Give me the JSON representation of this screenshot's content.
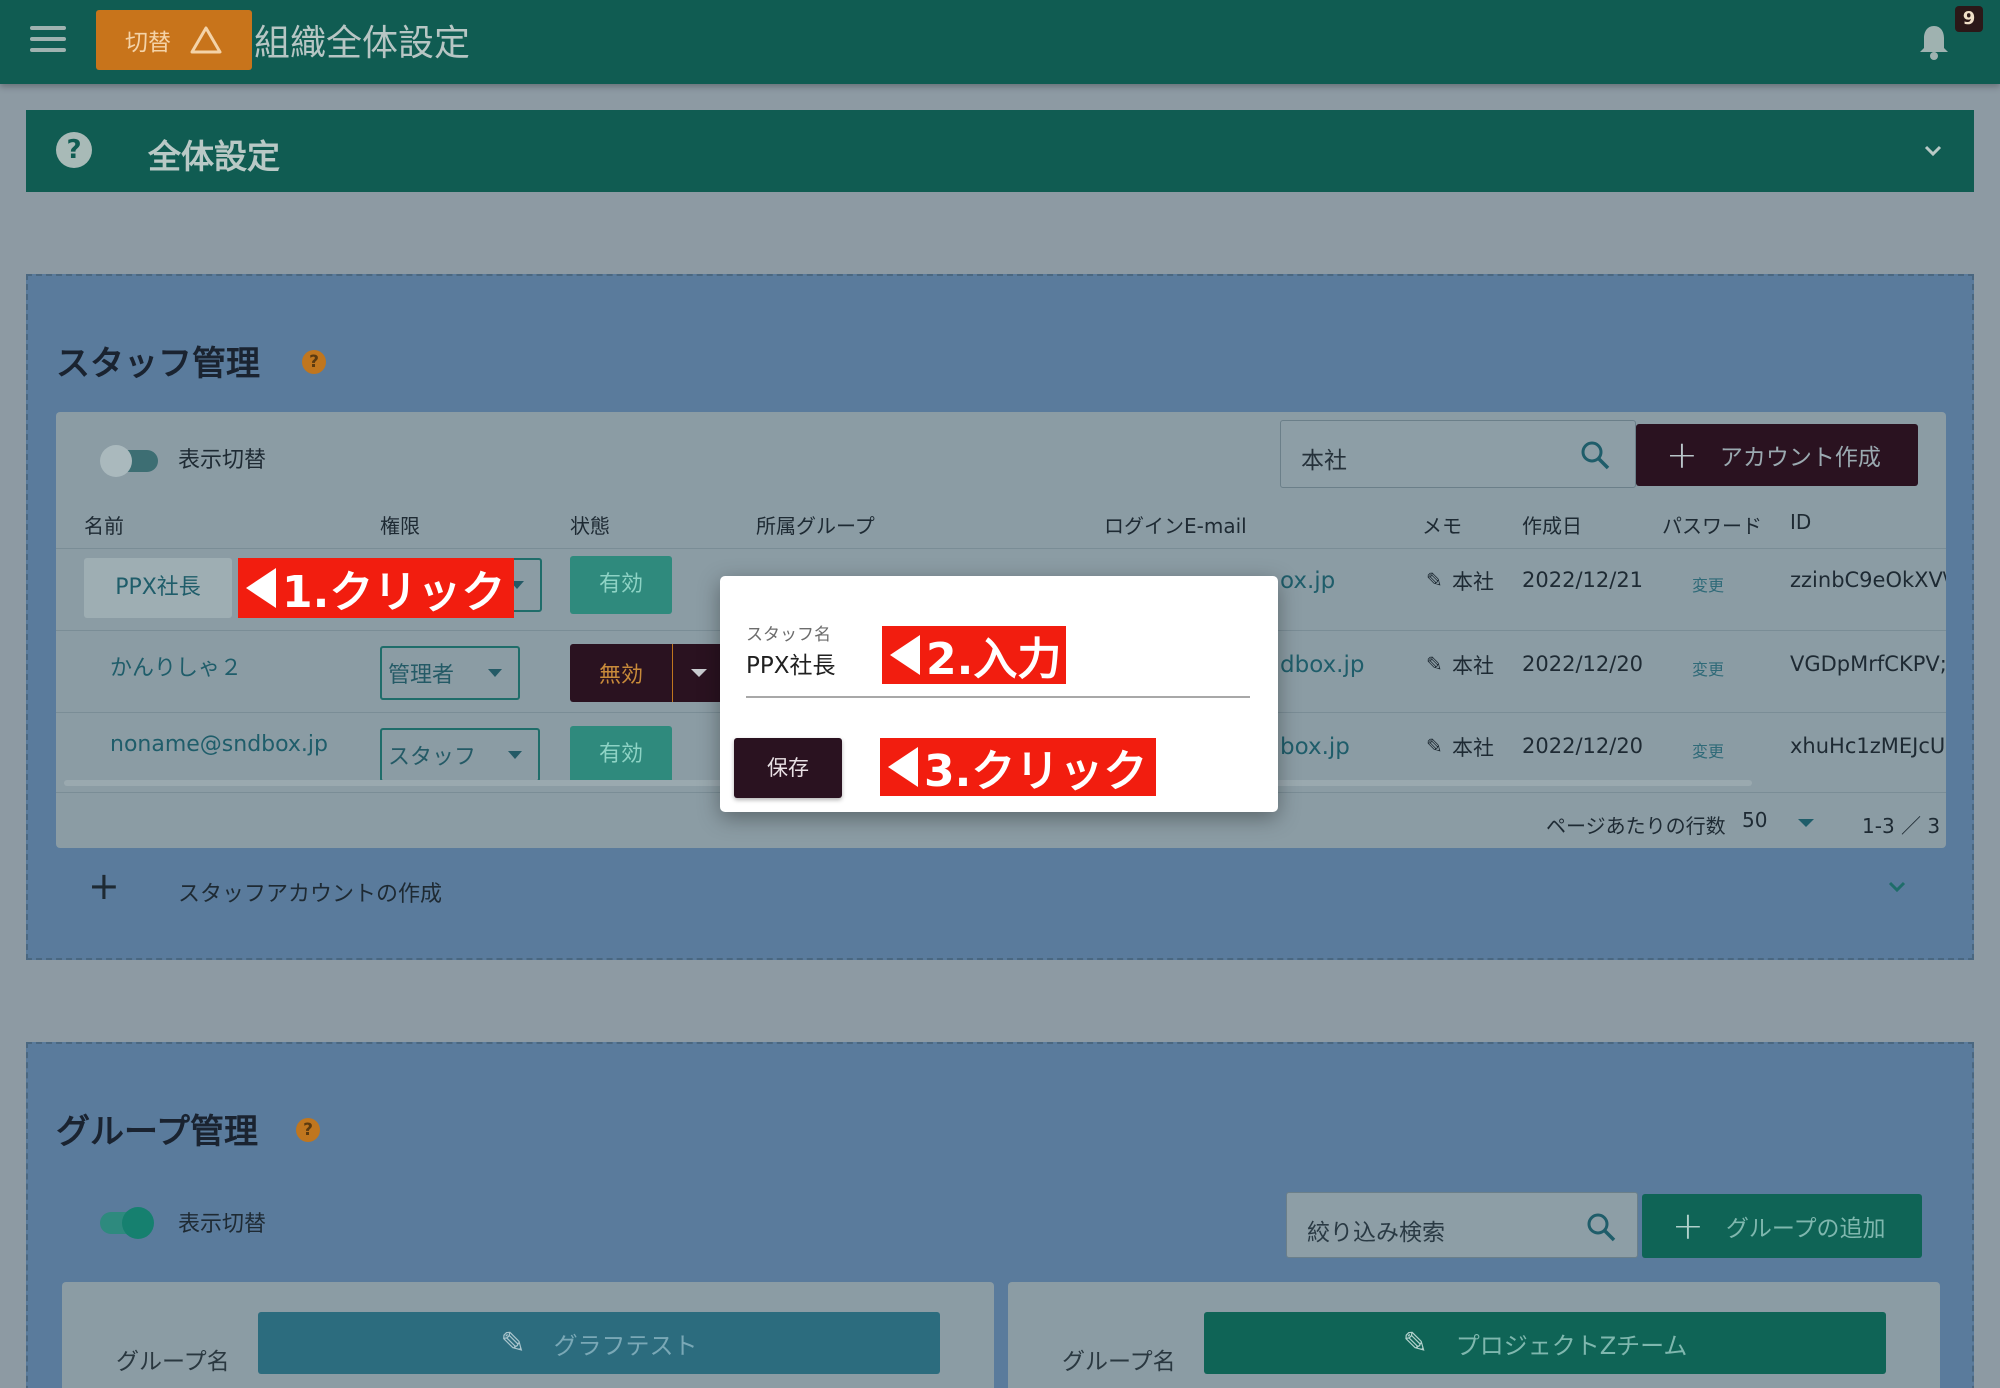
{
  "header": {
    "switch_label": "切替",
    "title": "組織全体設定",
    "notification_count": "9"
  },
  "settings": {
    "title": "全体設定"
  },
  "staff": {
    "title": "スタッフ管理",
    "toggle_label": "表示切替",
    "search_value": "本社",
    "create_button": "アカウント作成",
    "columns": [
      "名前",
      "権限",
      "状態",
      "所属グループ",
      "ログインE-mail",
      "メモ",
      "作成日",
      "パスワード",
      "ID"
    ],
    "rows": [
      {
        "name": "PPX社長",
        "role": "",
        "status": "有効",
        "email": "ox.jp",
        "memo": "本社",
        "created": "2022/12/21",
        "password": "変更",
        "id": "zzinbC9eOkXV\\"
      },
      {
        "name": "かんりしゃ２",
        "role": "管理者",
        "status": "無効",
        "email": "dbox.jp",
        "memo": "本社",
        "created": "2022/12/20",
        "password": "変更",
        "id": "VGDpMrfCKPV;"
      },
      {
        "name": "noname@sndbox.jp",
        "role": "スタッフ",
        "status": "有効",
        "email": "box.jp",
        "memo": "本社",
        "created": "2022/12/20",
        "password": "変更",
        "id": "xhuHc1zMEJcU"
      }
    ],
    "rows_per_page_label": "ページあたりの行数",
    "rows_per_page": "50",
    "range": "1-3 ／ 3",
    "create_staff_label": "スタッフアカウントの作成"
  },
  "group": {
    "title": "グループ管理",
    "toggle_label": "表示切替",
    "search_placeholder": "絞り込み検索",
    "add_button": "グループの追加",
    "cards": [
      {
        "label": "グループ名",
        "name": "グラフテスト"
      },
      {
        "label": "グループ名",
        "name": "プロジェクトZチーム"
      }
    ]
  },
  "dialog": {
    "label": "スタッフ名",
    "value": "PPX社長",
    "save_button": "保存"
  },
  "callouts": [
    "1.クリック",
    "2.入力",
    "3.クリック"
  ],
  "colors": {
    "header": "#105c52",
    "panel": "#5a7b9c",
    "accent_orange": "#c8741b",
    "callout_red": "#f21d0f",
    "dark_button": "#2a1220"
  }
}
